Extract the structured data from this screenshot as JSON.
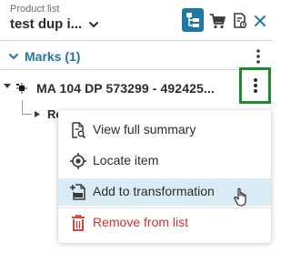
{
  "header": {
    "product_label": "Product list",
    "product_name": "test dup i...",
    "tree_view_active": true
  },
  "marks": {
    "title": "Marks (1)"
  },
  "item": {
    "label": "MA 104 DP 573299 - 492425...",
    "child_label": "Re"
  },
  "context_menu": {
    "items": [
      {
        "label": "View full summary",
        "icon": "document-search-icon"
      },
      {
        "label": "Locate item",
        "icon": "locate-target-icon"
      },
      {
        "label": "Add to transformation",
        "icon": "add-to-file-icon",
        "highlighted": true
      },
      {
        "label": "Remove from list",
        "icon": "trash-icon",
        "color": "#d0312d"
      }
    ]
  },
  "colors": {
    "accent": "#1f77a8",
    "highlight_box": "#1f8a2a",
    "danger": "#d0312d",
    "menu_hover": "#d9ecf6"
  }
}
